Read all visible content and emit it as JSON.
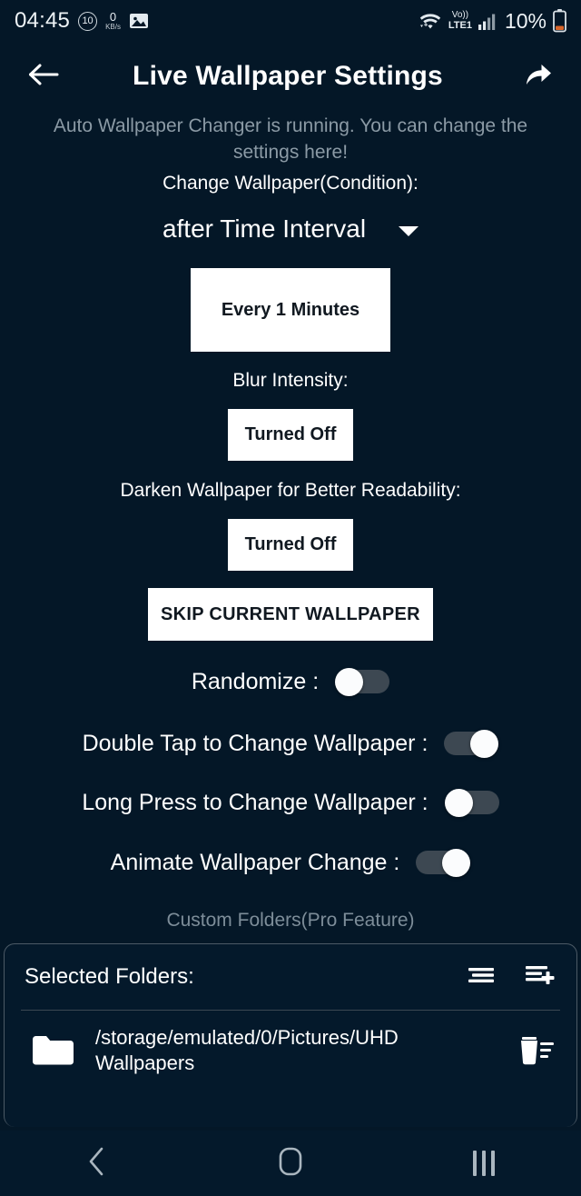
{
  "status_bar": {
    "clock": "04:45",
    "badge_count": "10",
    "net_speed_value": "0",
    "net_speed_unit": "KB/s",
    "gallery_icon": "image-icon",
    "wifi_icon": "wifi-icon",
    "volte_label": "Vo))",
    "network_label": "LTE1",
    "signal_icon": "signal-bars-icon",
    "battery_percent": "10%",
    "battery_icon": "battery-low-icon"
  },
  "app_bar": {
    "back_icon": "arrow-left-icon",
    "title": "Live Wallpaper Settings",
    "share_icon": "share-icon"
  },
  "subtitle": "Auto Wallpaper Changer is running. You can change the settings here!",
  "settings": {
    "condition_label": "Change Wallpaper(Condition):",
    "condition_value": "after Time Interval",
    "interval_button": "Every 1 Minutes",
    "blur_label": "Blur Intensity:",
    "blur_button": "Turned Off",
    "darken_label": "Darken Wallpaper for Better Readability:",
    "darken_button": "Turned Off",
    "skip_button": "SKIP CURRENT WALLPAPER"
  },
  "toggles": [
    {
      "label": "Randomize :",
      "state": "off"
    },
    {
      "label": "Double Tap to Change Wallpaper :",
      "state": "on"
    },
    {
      "label": "Long Press to Change Wallpaper :",
      "state": "off"
    },
    {
      "label": "Animate Wallpaper Change :",
      "state": "on"
    }
  ],
  "custom_folders": {
    "section_label": "Custom Folders(Pro Feature)",
    "header_title": "Selected Folders:",
    "sort_icon": "list-sort-icon",
    "add_icon": "playlist-add-icon",
    "rows": [
      {
        "folder_icon": "folder-icon",
        "path": "/storage/emulated/0/Pictures/UHD Wallpapers",
        "delete_icon": "delete-sweep-icon"
      }
    ]
  },
  "nav_bar": {
    "back_icon": "nav-back-icon",
    "home_icon": "nav-home-icon",
    "recents_icon": "nav-recents-icon"
  },
  "colors": {
    "background": "#041727",
    "card": "#04192b",
    "accent_white": "#ffffff",
    "muted_text": "#8b9aa5",
    "toggle_track": "#3d4852",
    "battery_low": "#d9652a"
  }
}
